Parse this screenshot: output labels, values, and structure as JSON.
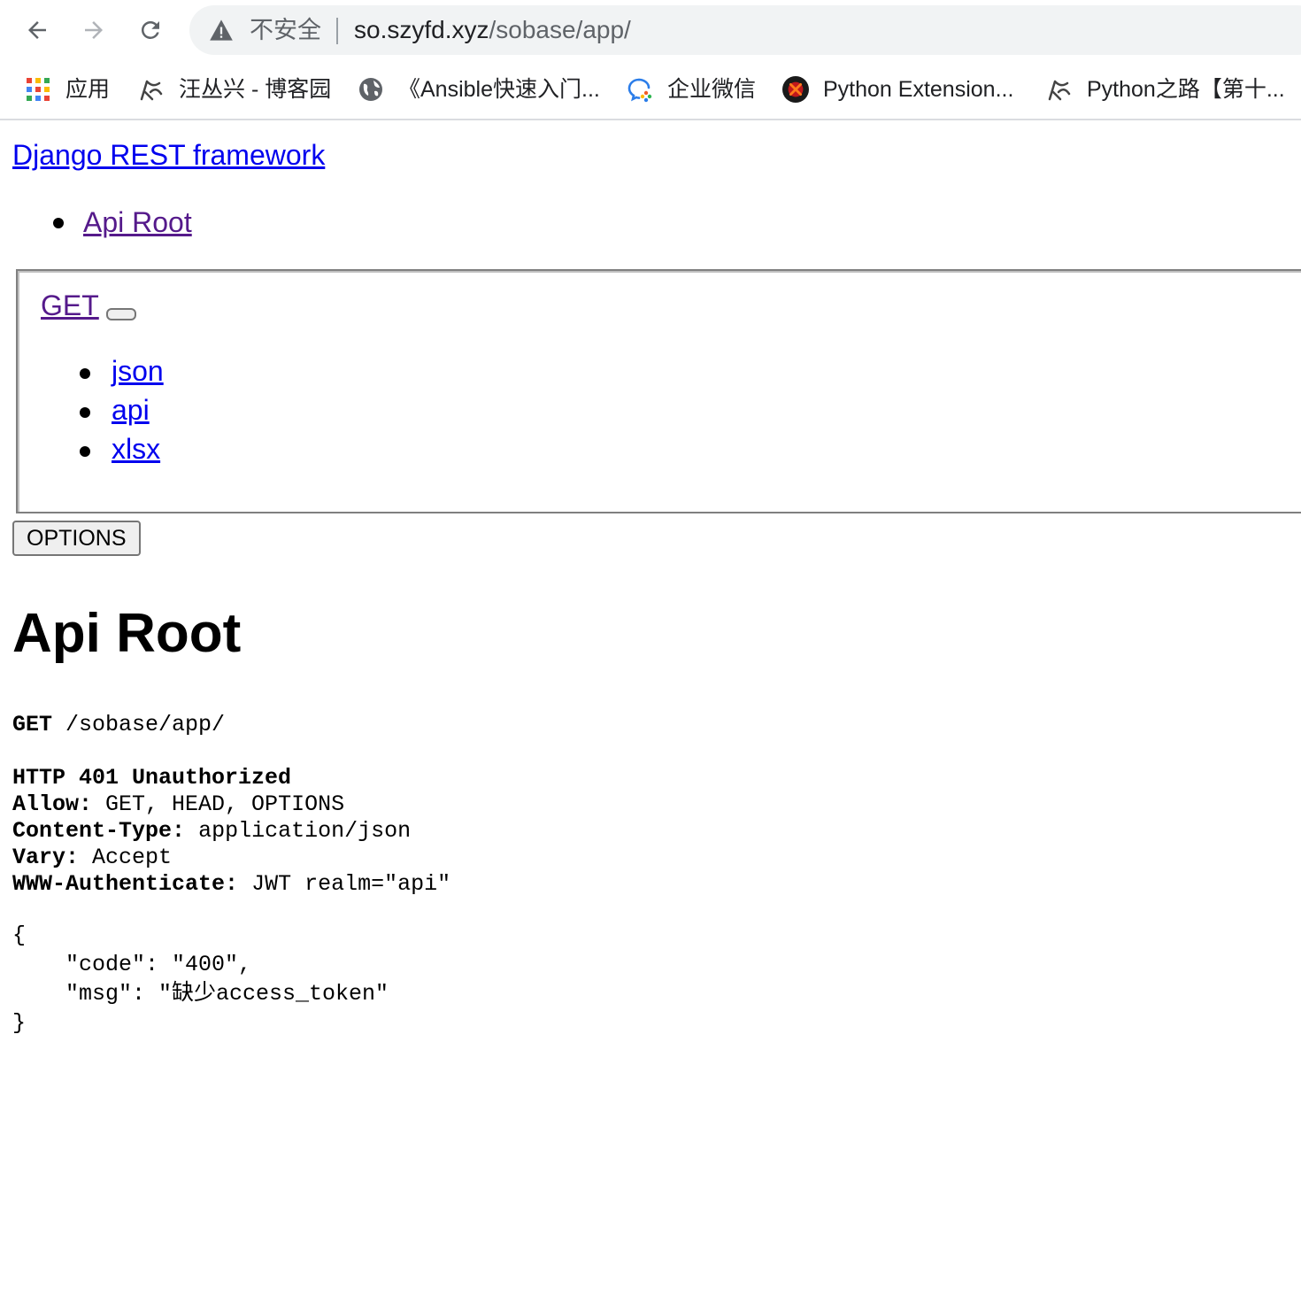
{
  "browser": {
    "insecure_label": "不安全",
    "url_host": "so.szyfd.xyz",
    "url_path": "/sobase/app/"
  },
  "bookmarks": [
    {
      "label": "应用",
      "icon": "apps-grid-icon"
    },
    {
      "label": "汪丛兴 - 博客园",
      "icon": "cnblogs-icon"
    },
    {
      "label": "《Ansible快速入门...",
      "icon": "globe-icon"
    },
    {
      "label": "企业微信",
      "icon": "wecom-icon"
    },
    {
      "label": "Python Extension...",
      "icon": "python-extension-icon"
    },
    {
      "label": "Python之路【第十...",
      "icon": "cnblogs-icon"
    }
  ],
  "page": {
    "brand": "Django REST framework",
    "breadcrumb": "Api Root",
    "get_label": "GET",
    "formats": [
      "json",
      "api",
      "xlsx"
    ],
    "options_label": "OPTIONS",
    "title": "Api Root"
  },
  "response": {
    "request_method": "GET",
    "request_path": "/sobase/app/",
    "status": "HTTP 401 Unauthorized",
    "headers": [
      {
        "name": "Allow:",
        "value": "GET, HEAD, OPTIONS"
      },
      {
        "name": "Content-Type:",
        "value": "application/json"
      },
      {
        "name": "Vary:",
        "value": "Accept"
      },
      {
        "name": "WWW-Authenticate:",
        "value": "JWT realm=\"api\""
      }
    ],
    "body": "{\n    \"code\": \"400\",\n    \"msg\": \"缺少access_token\"\n}"
  },
  "colors": {
    "link": "#0000ee",
    "visited_link": "#551a8b",
    "omnibox_bg": "#f1f3f4"
  }
}
